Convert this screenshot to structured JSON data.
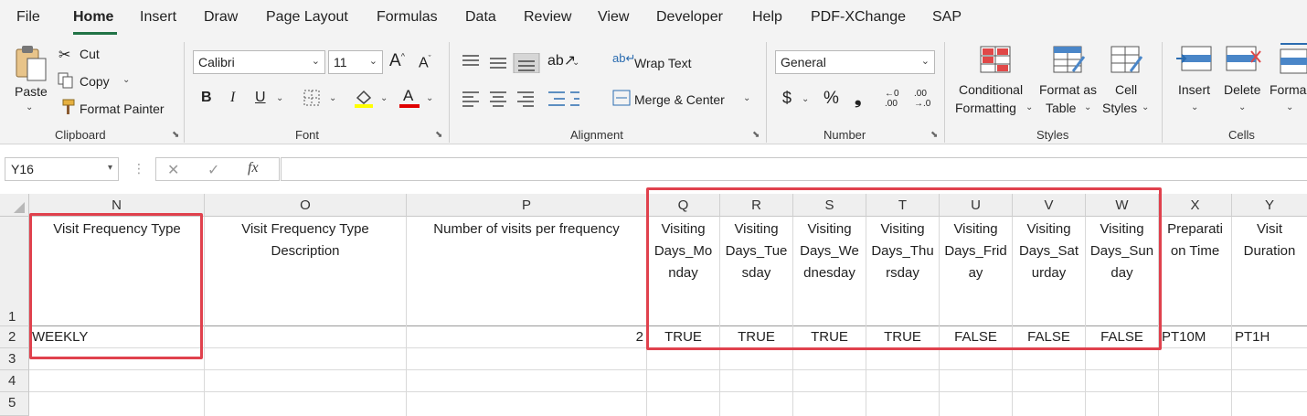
{
  "menu": [
    "File",
    "Home",
    "Insert",
    "Draw",
    "Page Layout",
    "Formulas",
    "Data",
    "Review",
    "View",
    "Developer",
    "Help",
    "PDF-XChange",
    "SAP"
  ],
  "ribbon": {
    "clipboard": {
      "paste": "Paste",
      "cut": "Cut",
      "copy": "Copy",
      "format_painter": "Format Painter",
      "label": "Clipboard"
    },
    "font": {
      "name": "Calibri",
      "size": "11",
      "bold": "B",
      "italic": "I",
      "underline": "U",
      "grow": "A",
      "shrink": "A",
      "label": "Font",
      "highlight_color": "#ffff00",
      "font_color": "#e00000"
    },
    "alignment": {
      "wrap_text": "Wrap Text",
      "merge_center": "Merge & Center",
      "label": "Alignment"
    },
    "number": {
      "format": "General",
      "currency": "$",
      "percent": "%",
      "comma": "❟",
      "inc_decimal_a": "←0",
      "inc_decimal_b": ".00",
      "dec_decimal_a": ".00",
      "dec_decimal_b": "→.0",
      "label": "Number"
    },
    "styles": {
      "conditional_1": "Conditional",
      "conditional_2": "Formatting",
      "format_table_1": "Format as",
      "format_table_2": "Table",
      "cell_styles_1": "Cell",
      "cell_styles_2": "Styles",
      "label": "Styles"
    },
    "cells": {
      "insert": "Insert",
      "delete": "Delete",
      "format": "Forma",
      "label": "Cells"
    }
  },
  "formula_bar": {
    "name_box": "Y16",
    "fx": "fx",
    "cancel": "✕",
    "enter": "✓",
    "value": ""
  },
  "columns": [
    "N",
    "O",
    "P",
    "Q",
    "R",
    "S",
    "T",
    "U",
    "V",
    "W",
    "X",
    "Y"
  ],
  "rows": [
    "1",
    "2",
    "3",
    "4",
    "5"
  ],
  "header_cells": {
    "N": [
      "Visit Frequency Type"
    ],
    "O": [
      "Visit Frequency Type",
      "Description"
    ],
    "P": [
      "Number of visits per frequency"
    ],
    "Q": [
      "Visiting",
      "Days_Mo",
      "nday"
    ],
    "R": [
      "Visiting",
      "Days_Tue",
      "sday"
    ],
    "S": [
      "Visiting",
      "Days_We",
      "dnesday"
    ],
    "T": [
      "Visiting",
      "Days_Thu",
      "rsday"
    ],
    "U": [
      "Visiting",
      "Days_Frid",
      "ay"
    ],
    "V": [
      "Visiting",
      "Days_Sat",
      "urday"
    ],
    "W": [
      "Visiting",
      "Days_Sun",
      "day"
    ],
    "X": [
      "Preparati",
      "on Time"
    ],
    "Y": [
      "Visit",
      "Duration"
    ]
  },
  "row2": {
    "N": "WEEKLY",
    "O": "",
    "P": "2",
    "Q": "TRUE",
    "R": "TRUE",
    "S": "TRUE",
    "T": "TRUE",
    "U": "FALSE",
    "V": "FALSE",
    "W": "FALSE",
    "X": "PT10M",
    "Y": "PT1H"
  },
  "highlight_color": "#e0414d"
}
